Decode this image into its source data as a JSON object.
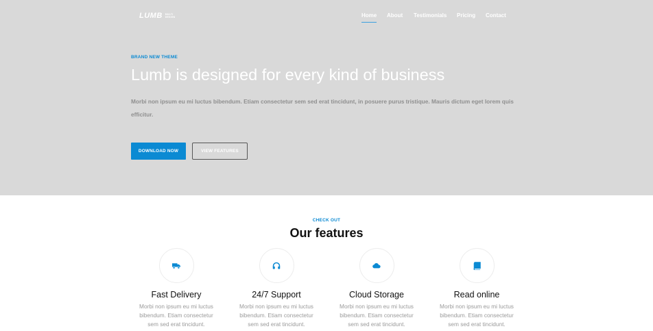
{
  "logo": {
    "word": "LUMB",
    "tag_line1": "MULTI",
    "tag_line2": "DESIGN"
  },
  "nav": {
    "items": [
      "Home",
      "About",
      "Testimonials",
      "Pricing",
      "Contact"
    ],
    "active": "Home"
  },
  "hero": {
    "eyebrow": "BRAND NEW THEME",
    "title": "Lumb is designed for every kind of business",
    "text": "Morbi non ipsum eu mi luctus bibendum. Etiam consectetur sem sed erat tincidunt, in posuere purus tristique. Mauris dictum eget lorem quis efficitur.",
    "primary_button": "DOWNLOAD NOW",
    "secondary_button": "VIEW FEATURES"
  },
  "features": {
    "eyebrow": "CHECK OUT",
    "title": "Our features",
    "items": [
      {
        "icon": "truck-icon",
        "title": "Fast Delivery",
        "text": "Morbi non ipsum eu mi luctus bibendum. Etiam consectetur sem sed erat tincidunt."
      },
      {
        "icon": "headset-icon",
        "title": "24/7 Support",
        "text": "Morbi non ipsum eu mi luctus bibendum. Etiam consectetur sem sed erat tincidunt."
      },
      {
        "icon": "cloud-icon",
        "title": "Cloud Storage",
        "text": "Morbi non ipsum eu mi luctus bibendum. Etiam consectetur sem sed erat tincidunt."
      },
      {
        "icon": "book-icon",
        "title": "Read online",
        "text": "Morbi non ipsum eu mi luctus bibendum. Etiam consectetur sem sed erat tincidunt."
      }
    ]
  },
  "colors": {
    "accent": "#0b8ad3",
    "hero_bg": "#d9d9d9"
  }
}
